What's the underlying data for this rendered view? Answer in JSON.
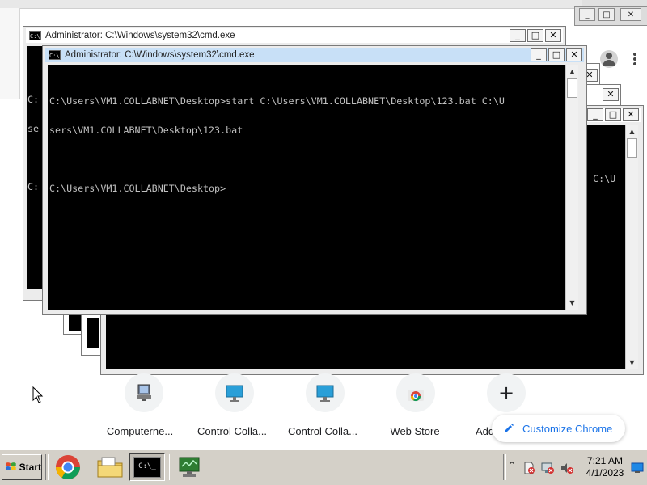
{
  "windows": {
    "back_cmd": {
      "title": "Administrator: C:\\Windows\\system32\\cmd.exe",
      "console_fragment_1": "C:",
      "console_fragment_2": "se",
      "console_fragment_3": "C:"
    },
    "front_cmd": {
      "title": "Administrator: C:\\Windows\\system32\\cmd.exe",
      "console_lines": [
        "C:\\Users\\VM1.COLLABNET\\Desktop>start C:\\Users\\VM1.COLLABNET\\Desktop\\123.bat C:\\U",
        "sers\\VM1.COLLABNET\\Desktop\\123.bat",
        "",
        "C:\\Users\\VM1.COLLABNET\\Desktop>"
      ]
    },
    "right_cmd": {
      "console_fragment": "t C:\\U"
    },
    "controls": {
      "minimize": "_",
      "maximize": "□",
      "close": "✕"
    }
  },
  "chrome": {
    "shortcuts": [
      {
        "label": "Computerne...",
        "icon": "computer-network-icon"
      },
      {
        "label": "Control Colla...",
        "icon": "monitor-icon"
      },
      {
        "label": "Control Colla...",
        "icon": "monitor-icon"
      },
      {
        "label": "Web Store",
        "icon": "chrome-webstore-icon"
      },
      {
        "label": "Add",
        "icon": "plus-icon"
      }
    ],
    "add_symbol": "+",
    "customize_label": "Customize Chrome"
  },
  "taskbar": {
    "start_label": "Start",
    "cmd_icon_text": "C:\\_",
    "clock_time": "7:21 AM",
    "clock_date": "4/1/2023",
    "tray_expand": "⌃"
  },
  "colors": {
    "console_bg": "#000000",
    "console_fg": "#c0c0c0",
    "active_title": "#c8e0f7",
    "chrome_accent": "#1a73e8",
    "taskbar": "#d4d0c8"
  }
}
